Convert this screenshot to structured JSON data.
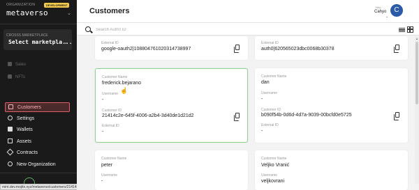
{
  "sidebar": {
    "org_label": "ORGANIZATION",
    "dev_badge": "DEVELOPMENT",
    "org_name": "metaverso",
    "marketplace_label": "CROSSS MARKETPLACE",
    "marketplace_value": "Select marketpla...",
    "dim_items": [
      {
        "label": "Sales",
        "icon": "sales-icon"
      },
      {
        "label": "NFTs",
        "icon": "nft-icon"
      }
    ],
    "items": [
      {
        "label": "Customers",
        "icon": "customers-icon",
        "active": true
      },
      {
        "label": "Settings",
        "icon": "gear-icon"
      },
      {
        "label": "Wallets",
        "icon": "wallet-icon"
      },
      {
        "label": "Assets",
        "icon": "assets-icon"
      },
      {
        "label": "Contracts",
        "icon": "contracts-icon"
      },
      {
        "label": "New Organization",
        "icon": "plus-icon"
      }
    ],
    "status_url": "mint.dev.mojito.xyz/metaverso/customers/21414c2e-645f-4006-a2b4-3d40de1d21d2...",
    "accent": "#e0606a"
  },
  "header": {
    "title": "Customers",
    "greeting": "Hey,",
    "user_name": "Cahyo",
    "avatar_letter": "C",
    "avatar_color": "#2b5aa8"
  },
  "search": {
    "placeholder": "Search Auth0 ID",
    "value": ""
  },
  "labels": {
    "customer_name": "Customer Name",
    "username": "Username",
    "customer_id": "Customer ID",
    "external_id": "External ID"
  },
  "cards": [
    {
      "external_id": "google-oauth2|108804761020314738997"
    },
    {
      "external_id": "auth0|620565023dbc0068b30378"
    },
    {
      "name": "frederick.bejarano",
      "username": "-",
      "customer_id": "21414c2e-645f-4006-a2b4-3d40de1d21d2",
      "external_id": "-"
    },
    {
      "name": "dan",
      "username": "-",
      "customer_id": "b090f54b-0d6d-4d7a-9039-00bcfd0e5725",
      "external_id": "-"
    },
    {
      "name": "peter",
      "username": "-"
    },
    {
      "name": "Veljko Vranić",
      "username": "veljkovrani"
    }
  ]
}
